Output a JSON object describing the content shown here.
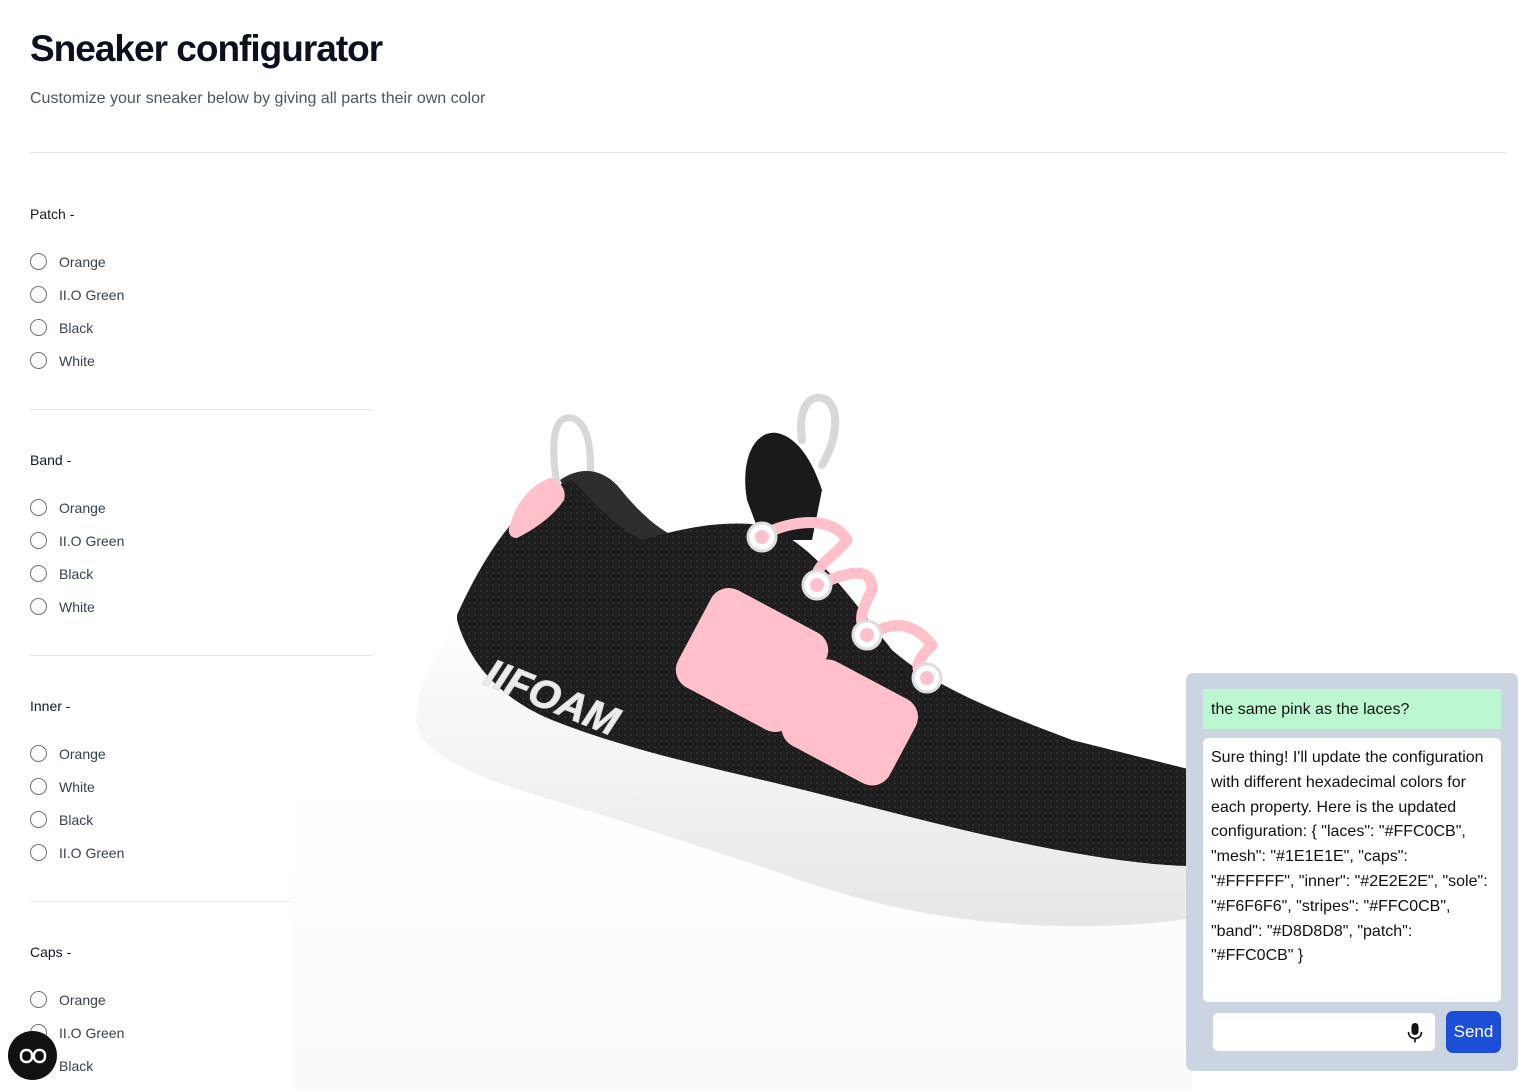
{
  "header": {
    "title": "Sneaker configurator",
    "subtitle": "Customize your sneaker below by giving all parts their own color"
  },
  "groups": [
    {
      "title": "Patch -",
      "options": [
        "Orange",
        "II.O Green",
        "Black",
        "White"
      ]
    },
    {
      "title": "Band -",
      "options": [
        "Orange",
        "II.O Green",
        "Black",
        "White"
      ]
    },
    {
      "title": "Inner -",
      "options": [
        "Orange",
        "White",
        "Black",
        "II.O Green"
      ]
    },
    {
      "title": "Caps -",
      "options": [
        "Orange",
        "II.O Green",
        "Black"
      ]
    }
  ],
  "viewer": {
    "sole_text": "IIFOAM",
    "colors": {
      "mesh": "#1E1E1E",
      "laces": "#FFC0CB",
      "stripes": "#FFC0CB",
      "patch": "#FFC0CB",
      "caps": "#FFFFFF",
      "sole": "#F6F6F6",
      "inner": "#2E2E2E",
      "loops": "#D8D8D8"
    }
  },
  "chat": {
    "messages": [
      {
        "role": "user",
        "text": "the same pink as the laces?"
      },
      {
        "role": "assistant",
        "text": "Sure thing! I'll update the configuration with different hexadecimal colors for each property. Here is the updated configuration: { \"laces\": \"#FFC0CB\", \"mesh\": \"#1E1E1E\", \"caps\": \"#FFFFFF\", \"inner\": \"#2E2E2E\", \"sole\": \"#F6F6F6\", \"stripes\": \"#FFC0CB\", \"band\": \"#D8D8D8\", \"patch\": \"#FFC0CB\" }"
      }
    ],
    "input_value": "",
    "mic_icon": "microphone-icon",
    "send_label": "Send"
  },
  "fab": {
    "icon": "glasses-icon"
  },
  "colors": {
    "send_button": "#1D4ED8",
    "chat_panel": "#CBD5E1",
    "user_bubble": "#BBF7D0"
  }
}
